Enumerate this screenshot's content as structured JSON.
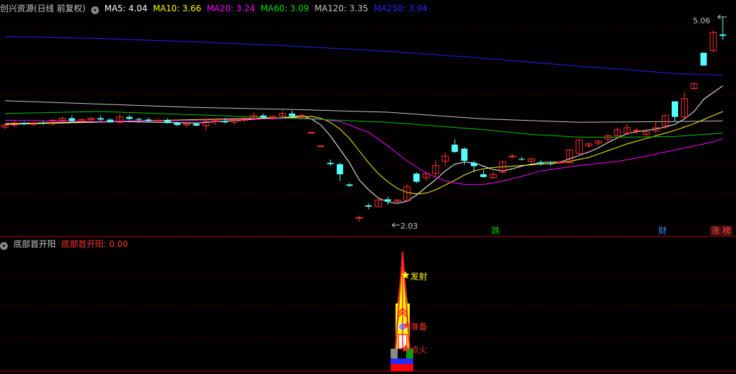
{
  "header": {
    "title": "创兴资源(日线 前复权)",
    "ma": [
      {
        "label": "MA5: 4.04",
        "color": "#ffffff"
      },
      {
        "label": "MA10: 3.66",
        "color": "#ffff00"
      },
      {
        "label": "MA20: 3.24",
        "color": "#ff00ff"
      },
      {
        "label": "MA60: 3.09",
        "color": "#00e000"
      },
      {
        "label": "MA120: 3.35",
        "color": "#c8c8c8"
      },
      {
        "label": "MA250: 3.94",
        "color": "#2828ff"
      }
    ]
  },
  "price_labels": {
    "high": "5.06",
    "low": "2.03"
  },
  "tags": [
    {
      "text": "跌",
      "color": "#00cc00"
    },
    {
      "text": "财",
      "color": "#3a8cff"
    },
    {
      "text": "涨",
      "color": "#ff4040"
    },
    {
      "text": "榜",
      "color": "#ff4040"
    }
  ],
  "indicator": {
    "name": "底部首开阳",
    "value_label": "底部首开阳: 0.00",
    "value_color": "#ff3030",
    "signals": {
      "fire": "发射",
      "ready": "准备",
      "ignite": "点火"
    }
  },
  "colors": {
    "up": "#ff3030",
    "down": "#54ffff",
    "grid": "#7a0000"
  },
  "chart_data": {
    "type": "candlestick",
    "ylim": [
      2.03,
      5.06
    ],
    "candles": [
      [
        3.43,
        3.48,
        3.4,
        3.46
      ],
      [
        3.46,
        3.52,
        3.43,
        3.49
      ],
      [
        3.49,
        3.51,
        3.46,
        3.47
      ],
      [
        3.47,
        3.5,
        3.44,
        3.49
      ],
      [
        3.49,
        3.52,
        3.46,
        3.48
      ],
      [
        3.48,
        3.55,
        3.45,
        3.53
      ],
      [
        3.53,
        3.58,
        3.5,
        3.56
      ],
      [
        3.56,
        3.6,
        3.49,
        3.52
      ],
      [
        3.52,
        3.56,
        3.48,
        3.54
      ],
      [
        3.54,
        3.58,
        3.51,
        3.56
      ],
      [
        3.56,
        3.6,
        3.52,
        3.54
      ],
      [
        3.54,
        3.56,
        3.49,
        3.5
      ],
      [
        3.5,
        3.62,
        3.48,
        3.58
      ],
      [
        3.58,
        3.61,
        3.53,
        3.55
      ],
      [
        3.55,
        3.57,
        3.51,
        3.54
      ],
      [
        3.54,
        3.57,
        3.5,
        3.52
      ],
      [
        3.52,
        3.55,
        3.49,
        3.53
      ],
      [
        3.53,
        3.56,
        3.48,
        3.49
      ],
      [
        3.49,
        3.51,
        3.44,
        3.46
      ],
      [
        3.46,
        3.5,
        3.43,
        3.48
      ],
      [
        3.48,
        3.5,
        3.44,
        3.45
      ],
      [
        3.45,
        3.55,
        3.38,
        3.51
      ],
      [
        3.51,
        3.56,
        3.46,
        3.52
      ],
      [
        3.52,
        3.56,
        3.48,
        3.5
      ],
      [
        3.5,
        3.54,
        3.47,
        3.53
      ],
      [
        3.53,
        3.58,
        3.5,
        3.56
      ],
      [
        3.56,
        3.65,
        3.54,
        3.6
      ],
      [
        3.6,
        3.63,
        3.55,
        3.57
      ],
      [
        3.57,
        3.6,
        3.54,
        3.59
      ],
      [
        3.59,
        3.67,
        3.56,
        3.63
      ],
      [
        3.63,
        3.67,
        3.58,
        3.59
      ],
      [
        3.59,
        3.63,
        3.56,
        3.6
      ],
      [
        3.35,
        3.35,
        3.35,
        3.35
      ],
      [
        3.15,
        3.15,
        3.15,
        3.15
      ],
      [
        2.9,
        2.95,
        2.86,
        2.88
      ],
      [
        2.88,
        2.9,
        2.63,
        2.73
      ],
      [
        2.58,
        2.6,
        2.54,
        2.56
      ],
      [
        2.09,
        2.12,
        2.03,
        2.09
      ],
      [
        2.27,
        2.3,
        2.21,
        2.25
      ],
      [
        2.25,
        2.38,
        2.24,
        2.35
      ],
      [
        2.36,
        2.4,
        2.28,
        2.33
      ],
      [
        2.33,
        2.36,
        2.31,
        2.35
      ],
      [
        2.34,
        2.58,
        2.33,
        2.55
      ],
      [
        2.74,
        2.76,
        2.6,
        2.62
      ],
      [
        2.68,
        2.77,
        2.63,
        2.74
      ],
      [
        2.74,
        2.93,
        2.69,
        2.86
      ],
      [
        2.92,
        3.05,
        2.85,
        3.0
      ],
      [
        3.17,
        3.25,
        3.05,
        3.06
      ],
      [
        3.11,
        3.13,
        2.87,
        2.93
      ],
      [
        2.9,
        2.93,
        2.76,
        2.85
      ],
      [
        2.73,
        2.79,
        2.68,
        2.69
      ],
      [
        2.68,
        2.76,
        2.66,
        2.73
      ],
      [
        2.76,
        2.94,
        2.74,
        2.91
      ],
      [
        3.0,
        3.04,
        2.96,
        3.0
      ],
      [
        2.96,
        2.99,
        2.93,
        2.95
      ],
      [
        2.92,
        2.97,
        2.9,
        2.96
      ],
      [
        2.91,
        2.94,
        2.86,
        2.89
      ],
      [
        2.89,
        2.91,
        2.86,
        2.88
      ],
      [
        2.9,
        2.93,
        2.88,
        2.91
      ],
      [
        2.9,
        3.1,
        2.89,
        3.09
      ],
      [
        3.04,
        3.26,
        3.0,
        3.24
      ],
      [
        3.15,
        3.2,
        3.12,
        3.18
      ],
      [
        3.19,
        3.24,
        3.15,
        3.22
      ],
      [
        3.25,
        3.33,
        3.2,
        3.3
      ],
      [
        3.3,
        3.42,
        3.27,
        3.39
      ],
      [
        3.34,
        3.48,
        3.31,
        3.42
      ],
      [
        3.37,
        3.42,
        3.32,
        3.38
      ],
      [
        3.32,
        3.38,
        3.28,
        3.36
      ],
      [
        3.37,
        3.5,
        3.34,
        3.42
      ],
      [
        3.45,
        3.62,
        3.4,
        3.6
      ],
      [
        3.81,
        3.81,
        3.51,
        3.58
      ],
      [
        3.58,
        3.95,
        3.55,
        3.85
      ],
      [
        4.0,
        4.09,
        3.98,
        4.07
      ],
      [
        4.53,
        4.53,
        4.34,
        4.34
      ],
      [
        4.56,
        4.86,
        4.54,
        4.83
      ],
      [
        4.8,
        5.06,
        4.72,
        4.78
      ]
    ],
    "ma": {
      "ma5": [
        [
          0,
          3.47
        ],
        [
          12,
          3.51
        ],
        [
          20,
          3.49
        ],
        [
          30,
          3.58
        ],
        [
          31,
          3.6
        ],
        [
          32,
          3.55
        ],
        [
          33,
          3.46
        ],
        [
          34,
          3.3
        ],
        [
          35,
          3.1
        ],
        [
          36,
          2.9
        ],
        [
          37,
          2.65
        ],
        [
          38,
          2.5
        ],
        [
          39,
          2.38
        ],
        [
          40,
          2.32
        ],
        [
          41,
          2.3
        ],
        [
          42,
          2.33
        ],
        [
          43,
          2.42
        ],
        [
          44,
          2.54
        ],
        [
          45,
          2.65
        ],
        [
          46,
          2.78
        ],
        [
          47,
          2.88
        ],
        [
          48,
          2.91
        ],
        [
          49,
          2.9
        ],
        [
          50,
          2.85
        ],
        [
          51,
          2.8
        ],
        [
          52,
          2.78
        ],
        [
          53,
          2.81
        ],
        [
          54,
          2.85
        ],
        [
          55,
          2.88
        ],
        [
          56,
          2.9
        ],
        [
          57,
          2.91
        ],
        [
          58,
          2.91
        ],
        [
          59,
          2.96
        ],
        [
          60,
          3.01
        ],
        [
          61,
          3.06
        ],
        [
          62,
          3.12
        ],
        [
          63,
          3.2
        ],
        [
          64,
          3.27
        ],
        [
          65,
          3.33
        ],
        [
          66,
          3.36
        ],
        [
          67,
          3.38
        ],
        [
          68,
          3.4
        ],
        [
          69,
          3.43
        ],
        [
          70,
          3.47
        ],
        [
          71,
          3.55
        ],
        [
          72,
          3.66
        ],
        [
          73,
          3.84
        ],
        [
          74,
          3.94
        ],
        [
          75,
          4.04
        ]
      ],
      "ma10": [
        [
          0,
          3.48
        ],
        [
          30,
          3.57
        ],
        [
          32,
          3.59
        ],
        [
          33,
          3.56
        ],
        [
          34,
          3.5
        ],
        [
          35,
          3.4
        ],
        [
          36,
          3.26
        ],
        [
          37,
          3.08
        ],
        [
          38,
          2.9
        ],
        [
          39,
          2.74
        ],
        [
          40,
          2.62
        ],
        [
          41,
          2.52
        ],
        [
          42,
          2.46
        ],
        [
          43,
          2.44
        ],
        [
          44,
          2.45
        ],
        [
          45,
          2.5
        ],
        [
          46,
          2.57
        ],
        [
          47,
          2.64
        ],
        [
          48,
          2.72
        ],
        [
          49,
          2.78
        ],
        [
          50,
          2.81
        ],
        [
          51,
          2.83
        ],
        [
          52,
          2.84
        ],
        [
          53,
          2.85
        ],
        [
          54,
          2.86
        ],
        [
          55,
          2.87
        ],
        [
          56,
          2.88
        ],
        [
          57,
          2.89
        ],
        [
          58,
          2.9
        ],
        [
          59,
          2.92
        ],
        [
          60,
          2.95
        ],
        [
          61,
          2.98
        ],
        [
          62,
          3.03
        ],
        [
          63,
          3.08
        ],
        [
          64,
          3.13
        ],
        [
          65,
          3.18
        ],
        [
          66,
          3.22
        ],
        [
          67,
          3.26
        ],
        [
          68,
          3.3
        ],
        [
          69,
          3.34
        ],
        [
          70,
          3.38
        ],
        [
          71,
          3.43
        ],
        [
          72,
          3.48
        ],
        [
          73,
          3.54
        ],
        [
          74,
          3.6
        ],
        [
          75,
          3.66
        ]
      ],
      "ma20": [
        [
          0,
          3.53
        ],
        [
          10,
          3.51
        ],
        [
          20,
          3.53
        ],
        [
          30,
          3.56
        ],
        [
          32,
          3.56
        ],
        [
          35,
          3.51
        ],
        [
          38,
          3.35
        ],
        [
          40,
          3.15
        ],
        [
          42,
          2.93
        ],
        [
          44,
          2.75
        ],
        [
          46,
          2.63
        ],
        [
          48,
          2.58
        ],
        [
          50,
          2.58
        ],
        [
          52,
          2.63
        ],
        [
          54,
          2.7
        ],
        [
          56,
          2.78
        ],
        [
          58,
          2.82
        ],
        [
          60,
          2.86
        ],
        [
          62,
          2.89
        ],
        [
          64,
          2.92
        ],
        [
          66,
          2.97
        ],
        [
          68,
          3.03
        ],
        [
          70,
          3.09
        ],
        [
          72,
          3.15
        ],
        [
          73,
          3.18
        ],
        [
          74,
          3.21
        ],
        [
          75,
          3.26
        ]
      ],
      "ma60": [
        [
          0,
          3.63
        ],
        [
          10,
          3.66
        ],
        [
          20,
          3.61
        ],
        [
          30,
          3.56
        ],
        [
          40,
          3.5
        ],
        [
          50,
          3.39
        ],
        [
          55,
          3.32
        ],
        [
          60,
          3.28
        ],
        [
          65,
          3.28
        ],
        [
          70,
          3.29
        ],
        [
          75,
          3.34
        ]
      ],
      "ma120": [
        [
          0,
          3.82
        ],
        [
          10,
          3.77
        ],
        [
          20,
          3.72
        ],
        [
          30,
          3.69
        ],
        [
          40,
          3.65
        ],
        [
          50,
          3.55
        ],
        [
          60,
          3.5
        ],
        [
          70,
          3.51
        ],
        [
          75,
          3.52
        ]
      ],
      "ma250": [
        [
          0,
          4.77
        ],
        [
          10,
          4.74
        ],
        [
          20,
          4.69
        ],
        [
          30,
          4.63
        ],
        [
          40,
          4.55
        ],
        [
          50,
          4.45
        ],
        [
          60,
          4.33
        ],
        [
          65,
          4.28
        ],
        [
          70,
          4.22
        ],
        [
          75,
          4.2
        ]
      ]
    }
  }
}
